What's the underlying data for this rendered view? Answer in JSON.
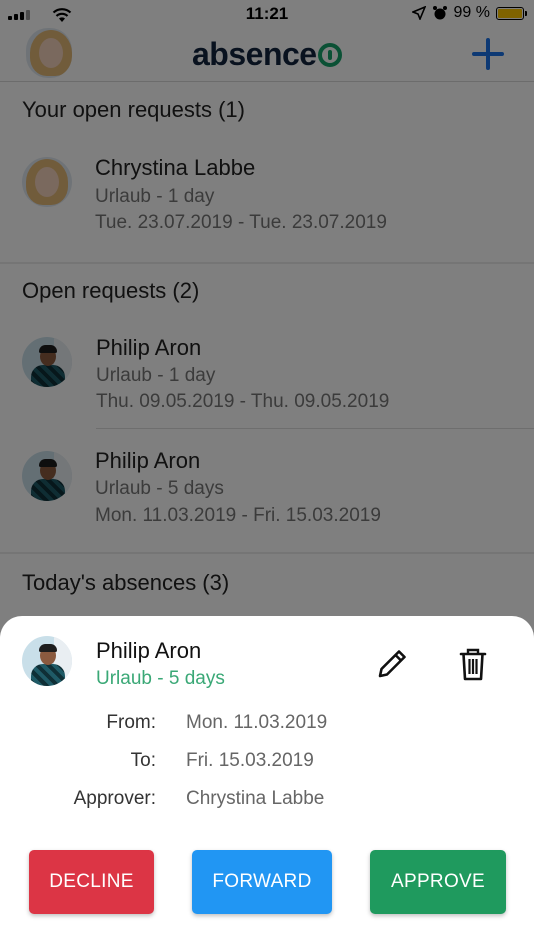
{
  "status": {
    "time": "11:21",
    "battery_percent": "99 %"
  },
  "header": {
    "logo_text": "absence",
    "logo_icon": "logo-power-icon",
    "add_icon": "plus-icon"
  },
  "sections": {
    "your_open": {
      "title": "Your open requests (1)",
      "items": [
        {
          "name": "Chrystina Labbe",
          "type": "Urlaub - 1 day",
          "dates": "Tue. 23.07.2019 - Tue. 23.07.2019"
        }
      ]
    },
    "open": {
      "title": "Open requests (2)",
      "items": [
        {
          "name": "Philip Aron",
          "type": "Urlaub - 1 day",
          "dates": "Thu. 09.05.2019 - Thu. 09.05.2019"
        },
        {
          "name": "Philip Aron",
          "type": "Urlaub - 5 days",
          "dates": "Mon. 11.03.2019 - Fri. 15.03.2019"
        }
      ]
    },
    "today": {
      "title": "Today's absences (3)"
    }
  },
  "sheet": {
    "name": "Philip Aron",
    "type": "Urlaub - 5 days",
    "from_label": "From:",
    "from_value": "Mon. 11.03.2019",
    "to_label": "To:",
    "to_value": "Fri. 15.03.2019",
    "approver_label": "Approver:",
    "approver_value": "Chrystina Labbe",
    "decline_label": "DECLINE",
    "forward_label": "FORWARD",
    "approve_label": "APPROVE",
    "colors": {
      "decline": "#dc3545",
      "forward": "#2196f3",
      "approve": "#1f9a5e",
      "type_text": "#3aa876"
    }
  }
}
